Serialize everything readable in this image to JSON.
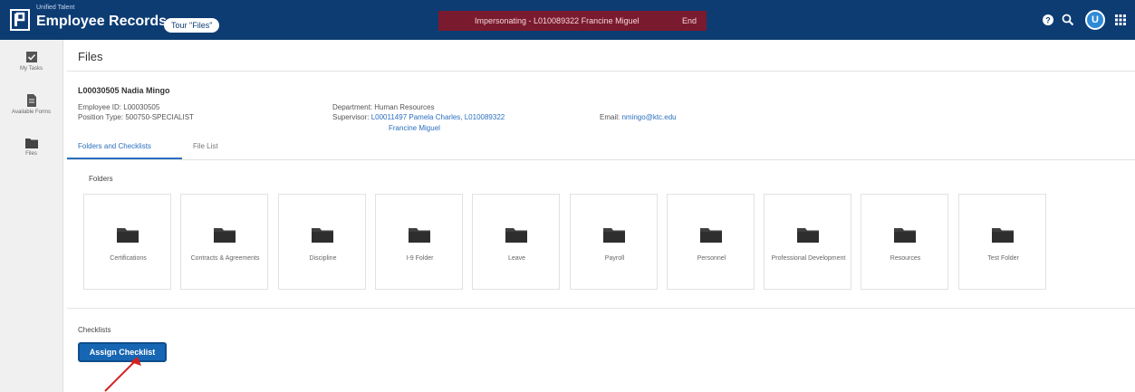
{
  "header": {
    "brand_small": "Unified Talent",
    "brand": "Employee Records",
    "tour_button": "Tour \"Files\"",
    "impersonating": "Impersonating - L010089322 Francine Miguel",
    "end_label": "End",
    "avatar_initial": "U"
  },
  "sidebar": {
    "items": [
      {
        "label": "My Tasks",
        "icon": "check-icon"
      },
      {
        "label": "Available Forms",
        "icon": "document-icon"
      },
      {
        "label": "Files",
        "icon": "folder-icon"
      }
    ]
  },
  "page": {
    "title": "Files",
    "employee_name": "L00030505 Nadia Mingo",
    "employee_id": "Employee ID: L00030505",
    "position_type": "Position Type: 500750-SPECIALIST",
    "department": "Department: Human Resources",
    "supervisor_label": "Supervisor:",
    "supervisor_line1": "L00011497 Pamela Charles, L010089322",
    "supervisor_line2": "Francine Miguel",
    "email_label": "Email:",
    "email": "nmingo@ktc.edu"
  },
  "tabs": [
    {
      "label": "Folders and Checklists",
      "active": true
    },
    {
      "label": "File List",
      "active": false
    }
  ],
  "folders_title": "Folders",
  "folders": [
    {
      "label": "Certifications"
    },
    {
      "label": "Contracts & Agreements"
    },
    {
      "label": "Discipline"
    },
    {
      "label": "I-9 Folder"
    },
    {
      "label": "Leave"
    },
    {
      "label": "Payroll"
    },
    {
      "label": "Personnel"
    },
    {
      "label": "Professional Development"
    },
    {
      "label": "Resources"
    },
    {
      "label": "Test Folder"
    }
  ],
  "checklists_title": "Checklists",
  "assign_button": "Assign Checklist",
  "colors": {
    "header": "#0d3c73",
    "banner": "#7a1a2e",
    "accent": "#1766b3",
    "annotation": "#d62020"
  }
}
